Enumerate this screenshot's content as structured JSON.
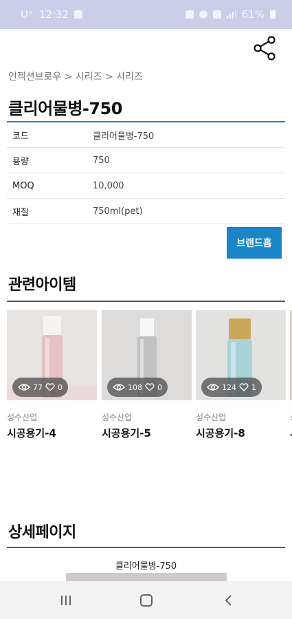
{
  "status_bar": {
    "carrier": "U⁺",
    "time": "12:32",
    "battery": "61%"
  },
  "share": {
    "icon": "share-icon"
  },
  "breadcrumb": {
    "items": [
      "인젝션브로우",
      "시리즈",
      "시리즈"
    ],
    "separator": ">",
    "text": "인젝션브로우 > 시리즈 > 시리즈"
  },
  "product": {
    "title": "클리어물병-750",
    "specs": [
      {
        "label": "코드",
        "value": "클리어물병-750"
      },
      {
        "label": "용량",
        "value": "750"
      },
      {
        "label": "MOQ",
        "value": "10,000"
      },
      {
        "label": "재질",
        "value": "750ml(pet)"
      }
    ],
    "brand_button": "브랜드홈",
    "accent_color": "#1a86c7"
  },
  "related": {
    "title": "관련아이템",
    "items": [
      {
        "company": "성수산업",
        "name": "시공용기-4",
        "views": "77",
        "likes": "0"
      },
      {
        "company": "성수산업",
        "name": "시공용기-5",
        "views": "108",
        "likes": "0"
      },
      {
        "company": "성수산업",
        "name": "시공용기-8",
        "views": "124",
        "likes": "1"
      },
      {
        "company": "성",
        "name": "시",
        "views": "",
        "likes": ""
      }
    ]
  },
  "detail": {
    "title": "상세페이지",
    "caption": "클리어물병-750"
  },
  "navigation": {
    "buttons": [
      "recent-apps",
      "home",
      "back"
    ]
  }
}
